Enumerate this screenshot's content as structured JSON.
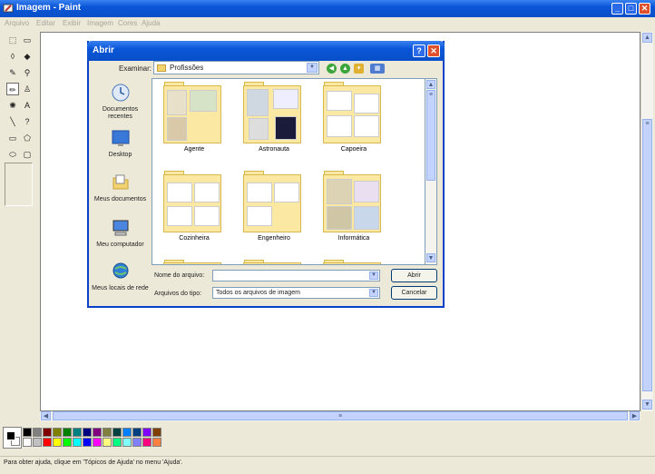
{
  "window": {
    "title": "Imagem - Paint"
  },
  "menu": [
    "Arquivo",
    "Editar",
    "Exibir",
    "Imagem",
    "Cores",
    "Ajuda"
  ],
  "status": "Para obter ajuda, clique em 'Tópicos de Ajuda' no menu 'Ajuda'.",
  "dialog": {
    "title": "Abrir",
    "look_in_label": "Examinar:",
    "look_in_value": "Profissões",
    "places": [
      "Documentos recentes",
      "Desktop",
      "Meus documentos",
      "Meu computador",
      "Meus locais de rede"
    ],
    "folders": [
      "Agente",
      "Astronauta",
      "Capoeira",
      "Cozinheira",
      "Engenheiro",
      "Informática"
    ],
    "file_name_label": "Nome do arquivo:",
    "file_name_value": "",
    "file_type_label": "Arquivos do tipo:",
    "file_type_value": "Todos os arquivos de imagem",
    "open_button": "Abrir",
    "cancel_button": "Cancelar"
  },
  "palette": {
    "top": [
      "#000000",
      "#808080",
      "#800000",
      "#808000",
      "#008000",
      "#008080",
      "#000080",
      "#800080",
      "#808040",
      "#004040",
      "#0080ff",
      "#004080",
      "#8000ff",
      "#804000"
    ],
    "bottom": [
      "#ffffff",
      "#c0c0c0",
      "#ff0000",
      "#ffff00",
      "#00ff00",
      "#00ffff",
      "#0000ff",
      "#ff00ff",
      "#ffff80",
      "#00ff80",
      "#80ffff",
      "#8080ff",
      "#ff0080",
      "#ff8040"
    ],
    "primary": "#000000",
    "secondary": "#ffffff"
  }
}
